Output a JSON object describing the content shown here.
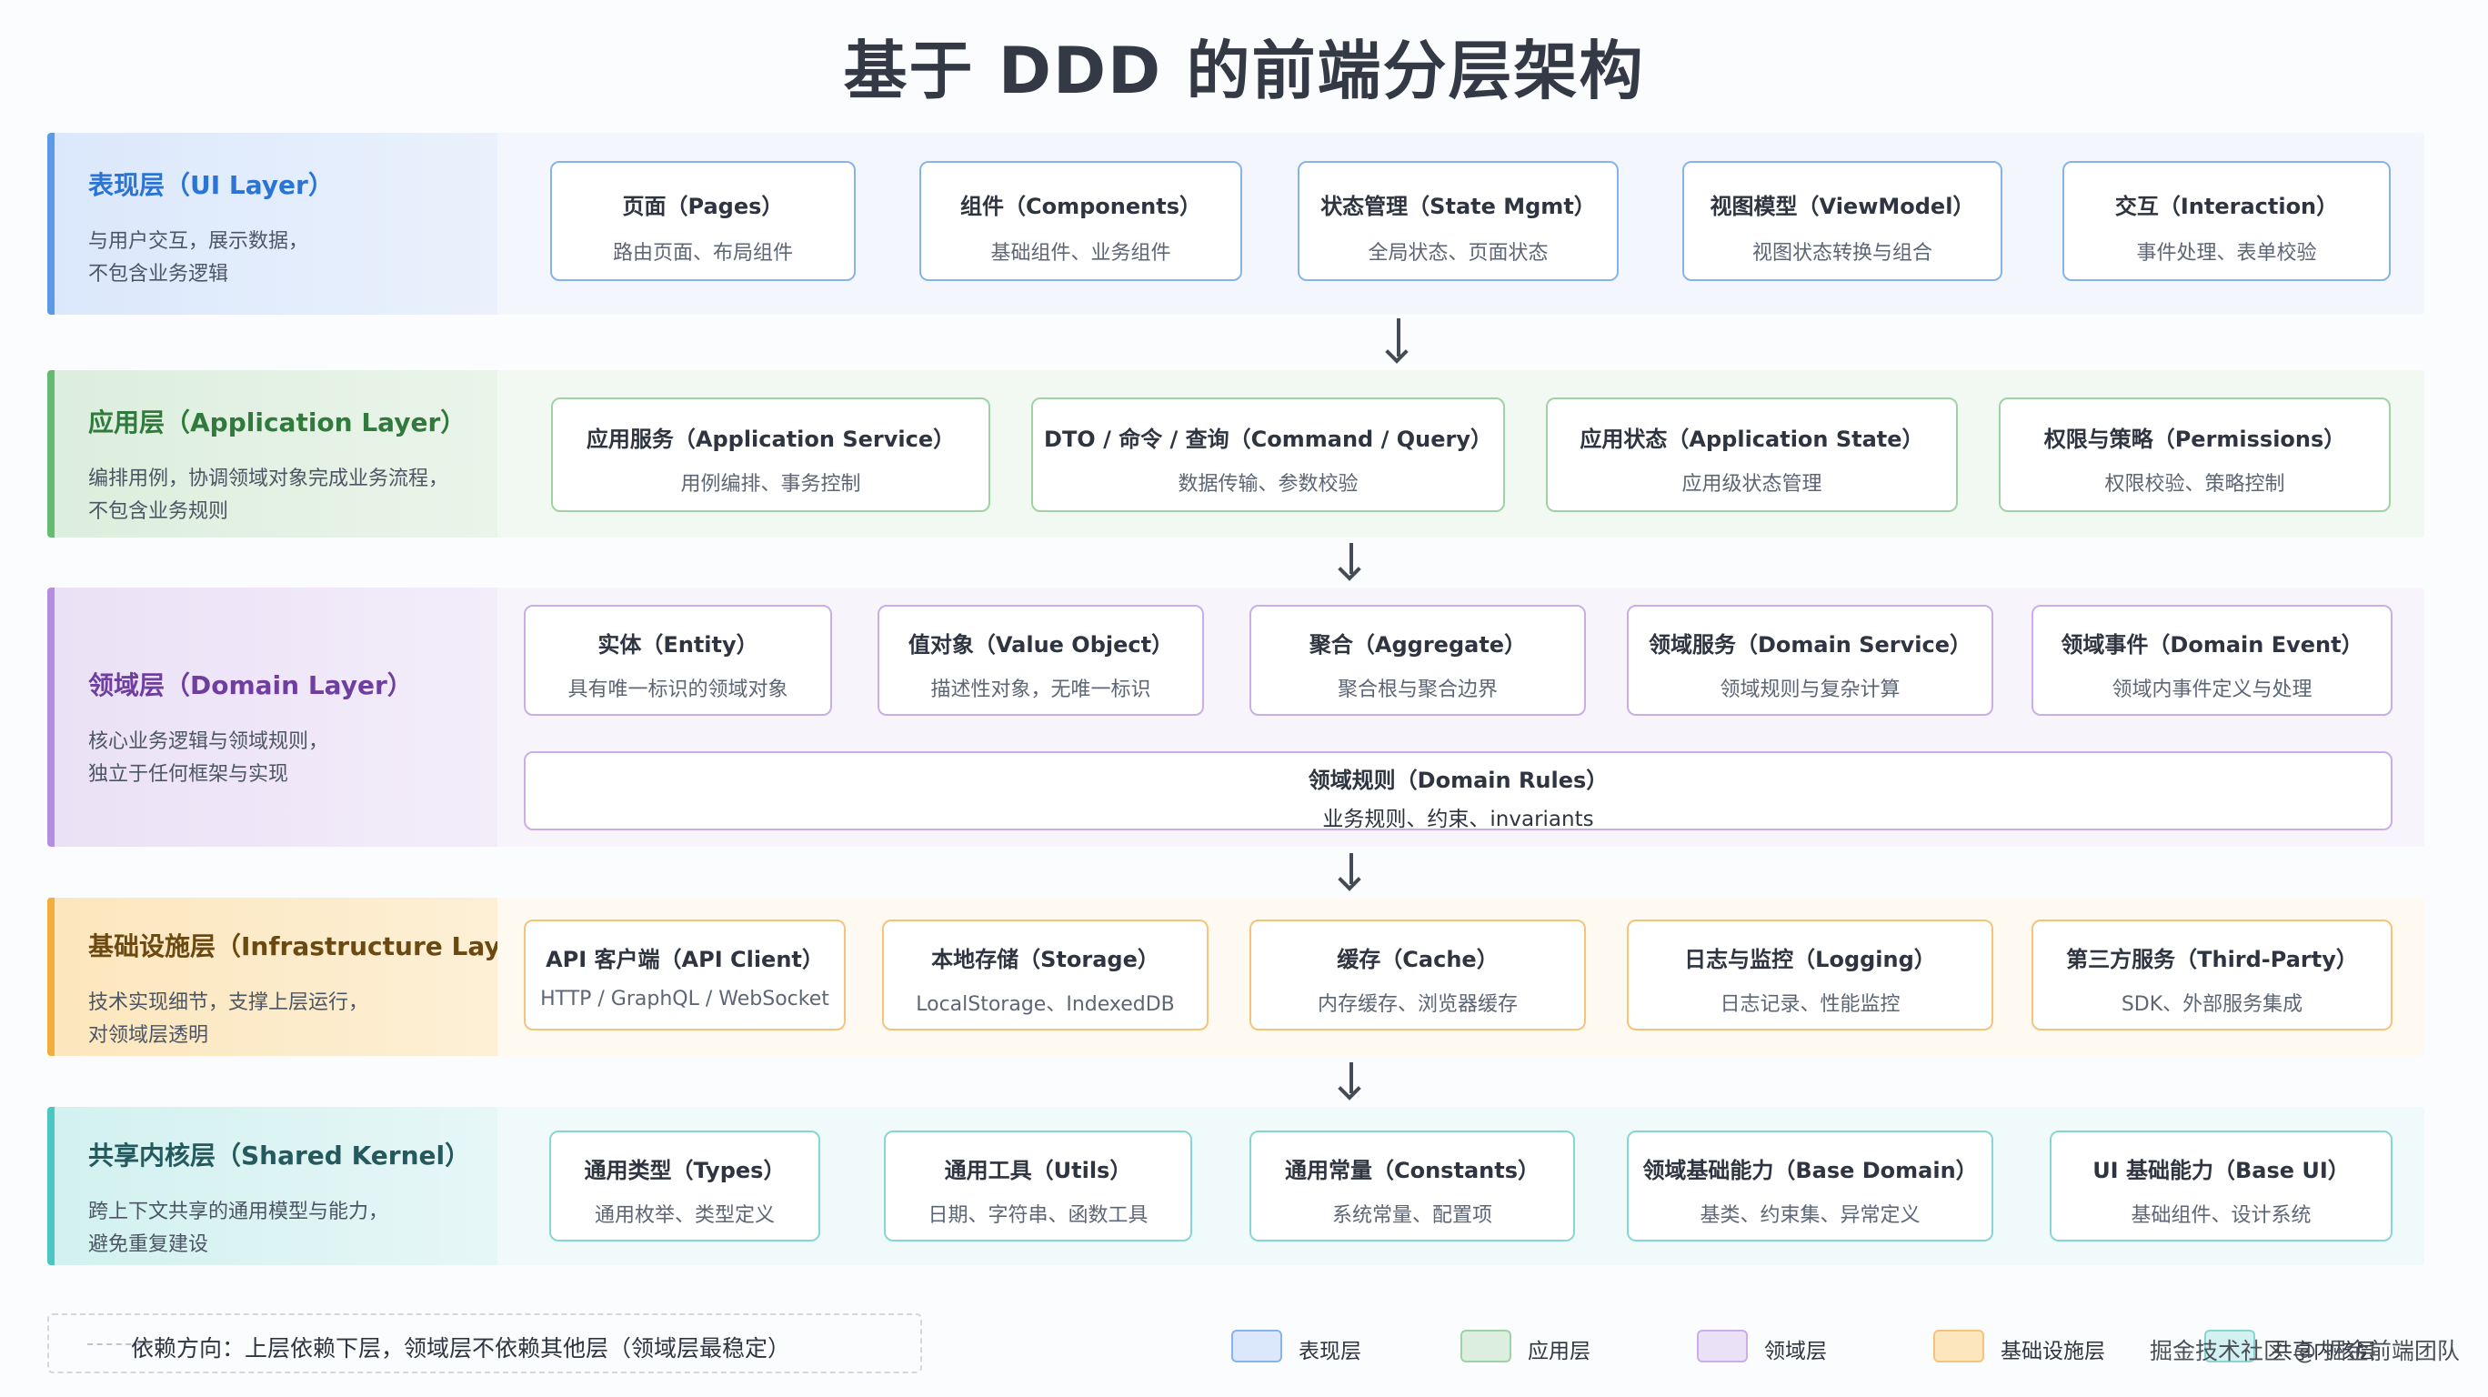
{
  "title": "基于 DDD 的前端分层架构",
  "layers": {
    "ui": {
      "name": "表现层（UI Layer）",
      "desc1": "与用户交互，展示数据，",
      "desc2": "不包含业务逻辑",
      "cards": [
        {
          "title": "页面（Pages）",
          "desc": "路由页面、布局组件"
        },
        {
          "title": "组件（Components）",
          "desc": "基础组件、业务组件"
        },
        {
          "title": "状态管理（State Mgmt）",
          "desc": "全局状态、页面状态"
        },
        {
          "title": "视图模型（ViewModel）",
          "desc": "视图状态转换与组合"
        },
        {
          "title": "交互（Interaction）",
          "desc": "事件处理、表单校验"
        }
      ]
    },
    "app": {
      "name": "应用层（Application Layer）",
      "desc1": "编排用例，协调领域对象完成业务流程，",
      "desc2": "不包含业务规则",
      "cards": [
        {
          "title": "应用服务（Application Service）",
          "desc": "用例编排、事务控制"
        },
        {
          "title": "DTO / 命令 / 查询（Command / Query）",
          "desc": "数据传输、参数校验"
        },
        {
          "title": "应用状态（Application State）",
          "desc": "应用级状态管理"
        },
        {
          "title": "权限与策略（Permissions）",
          "desc": "权限校验、策略控制"
        }
      ]
    },
    "domain": {
      "name": "领域层（Domain Layer）",
      "desc1": "核心业务逻辑与领域规则，",
      "desc2": "独立于任何框架与实现",
      "cards": [
        {
          "title": "实体（Entity）",
          "desc": "具有唯一标识的领域对象"
        },
        {
          "title": "值对象（Value Object）",
          "desc": "描述性对象，无唯一标识"
        },
        {
          "title": "聚合（Aggregate）",
          "desc": "聚合根与聚合边界"
        },
        {
          "title": "领域服务（Domain Service）",
          "desc": "领域规则与复杂计算"
        },
        {
          "title": "领域事件（Domain Event）",
          "desc": "领域内事件定义与处理"
        }
      ],
      "rules": {
        "title": "领域规则（Domain Rules）",
        "desc": "业务规则、约束、invariants"
      }
    },
    "infra": {
      "name": "基础设施层（Infrastructure Layer）",
      "desc1": "技术实现细节，支撑上层运行，",
      "desc2": "对领域层透明",
      "cards": [
        {
          "title": "API 客户端（API Client）",
          "desc": "HTTP / GraphQL / WebSocket"
        },
        {
          "title": "本地存储（Storage）",
          "desc": "LocalStorage、IndexedDB"
        },
        {
          "title": "缓存（Cache）",
          "desc": "内存缓存、浏览器缓存"
        },
        {
          "title": "日志与监控（Logging）",
          "desc": "日志记录、性能监控"
        },
        {
          "title": "第三方服务（Third-Party）",
          "desc": "SDK、外部服务集成"
        }
      ]
    },
    "shared": {
      "name": "共享内核层（Shared Kernel）",
      "desc1": "跨上下文共享的通用模型与能力，",
      "desc2": "避免重复建设",
      "cards": [
        {
          "title": "通用类型（Types）",
          "desc": "通用枚举、类型定义"
        },
        {
          "title": "通用工具（Utils）",
          "desc": "日期、字符串、函数工具"
        },
        {
          "title": "通用常量（Constants）",
          "desc": "系统常量、配置项"
        },
        {
          "title": "领域基础能力（Base Domain）",
          "desc": "基类、约束集、异常定义"
        },
        {
          "title": "UI 基础能力（Base UI）",
          "desc": "基础组件、设计系统"
        }
      ]
    }
  },
  "footer": {
    "dependency_note": "依赖方向：上层依赖下层，领域层不依赖其他层（领域层最稳定）"
  },
  "legend": [
    {
      "label": "表现层",
      "color": "#dbe8fb",
      "border": "#86b4ea"
    },
    {
      "label": "应用层",
      "color": "#dceedd",
      "border": "#9ed3a5"
    },
    {
      "label": "领域层",
      "color": "#ebe1f6",
      "border": "#c9aee8"
    },
    {
      "label": "基础设施层",
      "color": "#fce6bd",
      "border": "#f5c37c"
    },
    {
      "label": "共享内核层",
      "color": "#d2f1f0",
      "border": "#86d6d3"
    }
  ],
  "watermark": "掘金技术社区 @ 掘金前端团队"
}
